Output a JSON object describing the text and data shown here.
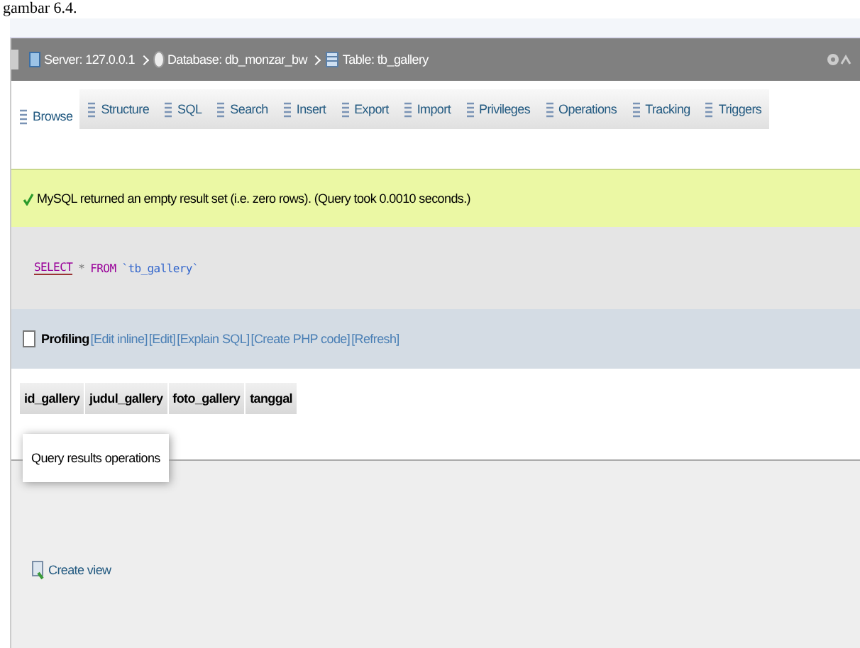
{
  "caption": "gambar 6.4.",
  "breadcrumb": [
    {
      "kind": "server",
      "label": "Server: 127.0.0.1"
    },
    {
      "kind": "database",
      "label": "Database: db_monzar_bw"
    },
    {
      "kind": "table",
      "label": "Table: tb_gallery"
    }
  ],
  "tabs": [
    {
      "label": "Browse",
      "selected": true
    },
    {
      "label": "Structure",
      "selected": false
    },
    {
      "label": "SQL",
      "selected": false
    },
    {
      "label": "Search",
      "selected": false
    },
    {
      "label": "Insert",
      "selected": false
    },
    {
      "label": "Export",
      "selected": false
    },
    {
      "label": "Import",
      "selected": false
    },
    {
      "label": "Privileges",
      "selected": false
    },
    {
      "label": "Operations",
      "selected": false
    },
    {
      "label": "Tracking",
      "selected": false
    },
    {
      "label": "Triggers",
      "selected": false
    }
  ],
  "message": "MySQL returned an empty result set (i.e. zero rows). (Query took 0.0010 seconds.)",
  "query": {
    "keyword1": "SELECT",
    "star": "*",
    "keyword2": "FROM",
    "table": "`tb_gallery`"
  },
  "profiling": {
    "label": "Profiling",
    "checked": false,
    "links": [
      "[Edit inline]",
      "[Edit]",
      "[Explain SQL]",
      "[Create PHP code]",
      "[Refresh]"
    ]
  },
  "columns": [
    "id_gallery",
    "judul_gallery",
    "foto_gallery",
    "tanggal"
  ],
  "operations": {
    "title": "Query results operations",
    "link": "Create view"
  }
}
